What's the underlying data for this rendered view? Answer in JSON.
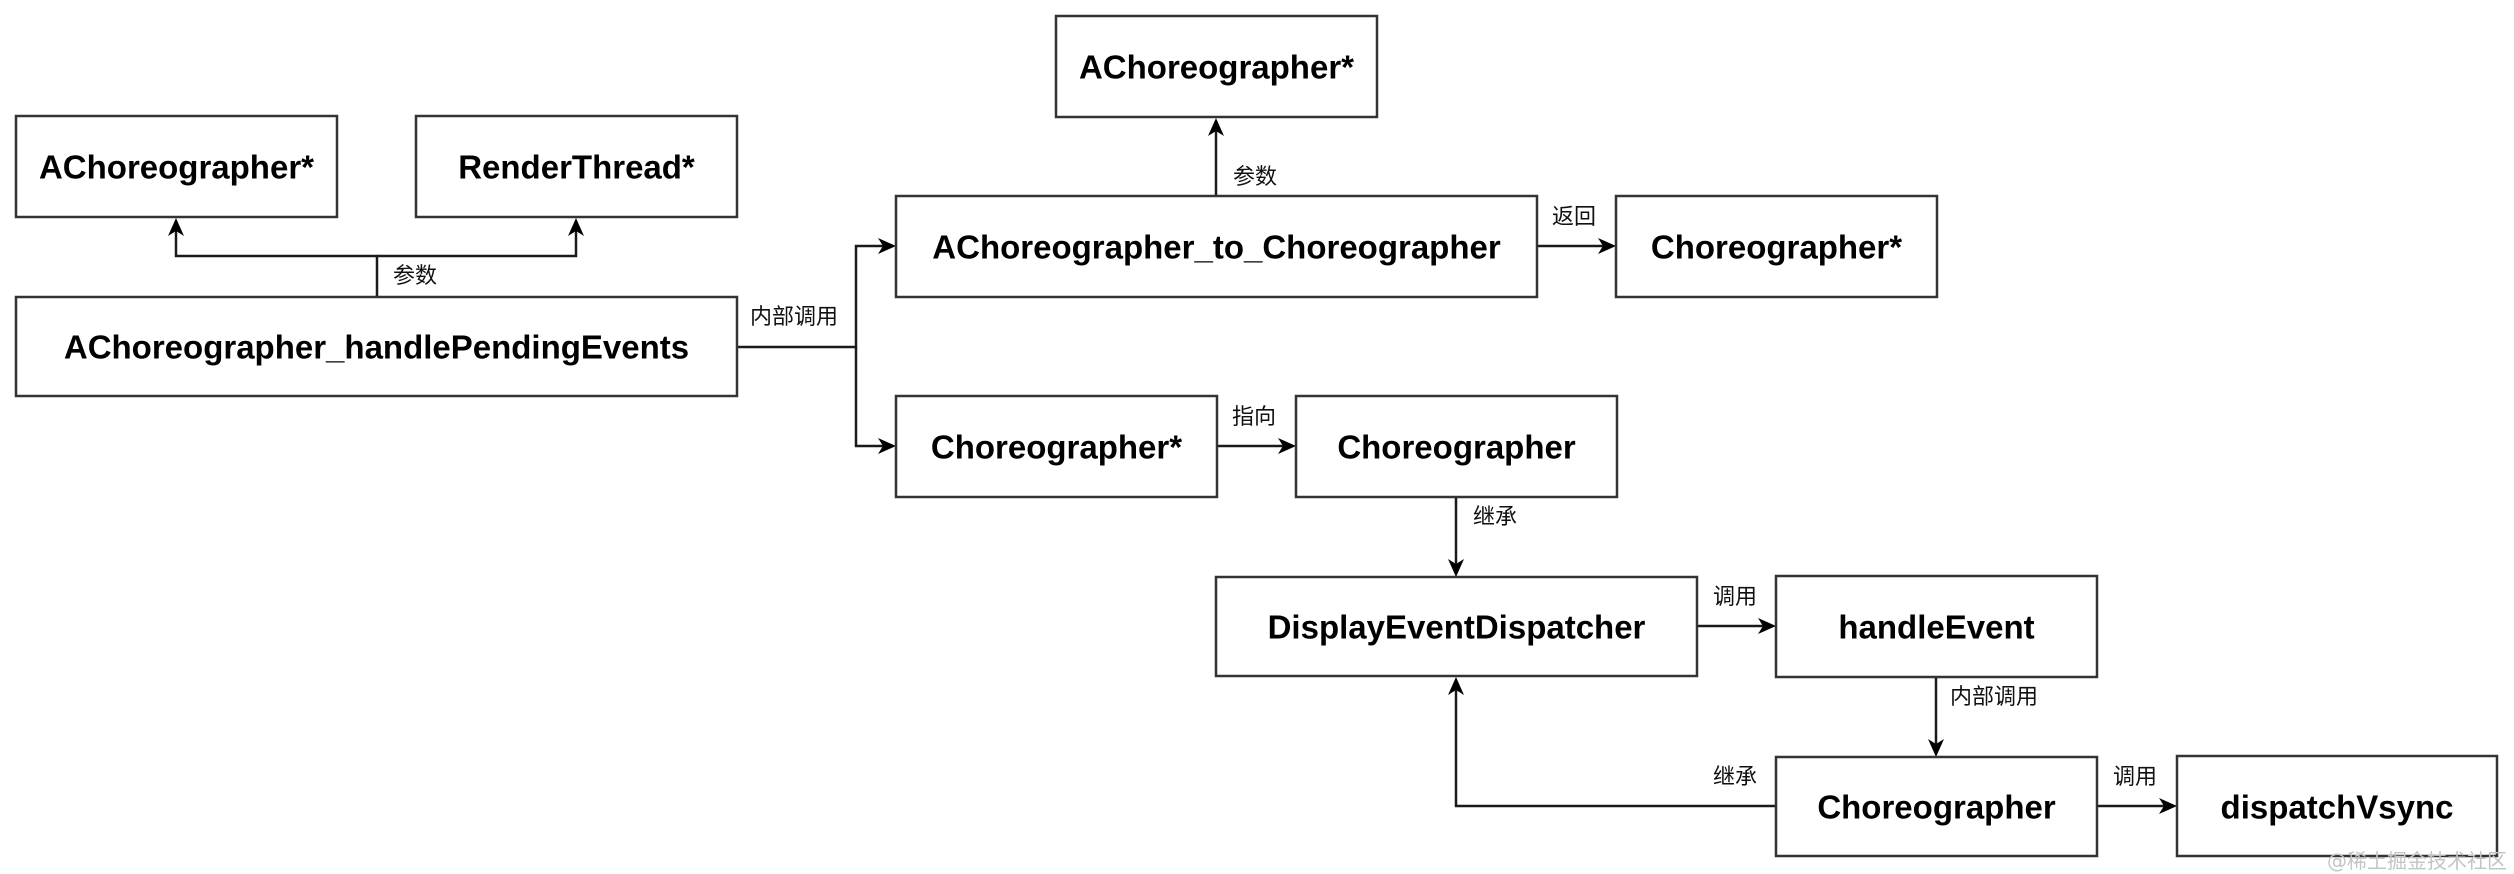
{
  "diagram": {
    "nodes": [
      {
        "id": "n_achoreographer_ptr_left",
        "label": "AChoreographer*"
      },
      {
        "id": "n_renderthread_ptr",
        "label": "RenderThread*"
      },
      {
        "id": "n_handle_pending_events",
        "label": "AChoreographer_handlePendingEvents"
      },
      {
        "id": "n_achoreographer_ptr_top",
        "label": "AChoreographer*"
      },
      {
        "id": "n_achoreographer_to_choreographer",
        "label": "AChoreographer_to_Choreographer"
      },
      {
        "id": "n_choreographer_ptr_right",
        "label": "Choreographer*"
      },
      {
        "id": "n_choreographer_ptr_mid",
        "label": "Choreographer*"
      },
      {
        "id": "n_choreographer_mid",
        "label": "Choreographer"
      },
      {
        "id": "n_display_event_dispatcher",
        "label": "DisplayEventDispatcher"
      },
      {
        "id": "n_handle_event",
        "label": "handleEvent"
      },
      {
        "id": "n_choreographer_bottom",
        "label": "Choreographer"
      },
      {
        "id": "n_dispatch_vsync",
        "label": "dispatchVsync"
      }
    ],
    "edges": [
      {
        "from": "n_handle_pending_events",
        "to": "n_achoreographer_ptr_left",
        "label": "参数"
      },
      {
        "from": "n_handle_pending_events",
        "to": "n_renderthread_ptr",
        "label": "参数"
      },
      {
        "from": "n_handle_pending_events",
        "to": "n_achoreographer_to_choreographer",
        "label": "内部调用"
      },
      {
        "from": "n_handle_pending_events",
        "to": "n_choreographer_ptr_mid",
        "label": "内部调用"
      },
      {
        "from": "n_achoreographer_to_choreographer",
        "to": "n_achoreographer_ptr_top",
        "label": "参数"
      },
      {
        "from": "n_achoreographer_to_choreographer",
        "to": "n_choreographer_ptr_right",
        "label": "返回"
      },
      {
        "from": "n_choreographer_ptr_mid",
        "to": "n_choreographer_mid",
        "label": "指向"
      },
      {
        "from": "n_choreographer_mid",
        "to": "n_display_event_dispatcher",
        "label": "继承"
      },
      {
        "from": "n_display_event_dispatcher",
        "to": "n_handle_event",
        "label": "调用"
      },
      {
        "from": "n_handle_event",
        "to": "n_choreographer_bottom",
        "label": "内部调用"
      },
      {
        "from": "n_choreographer_bottom",
        "to": "n_display_event_dispatcher",
        "label": "继承"
      },
      {
        "from": "n_choreographer_bottom",
        "to": "n_dispatch_vsync",
        "label": "调用"
      }
    ],
    "edge_labels": {
      "params_left": "参数",
      "internal_call_left": "内部调用",
      "params_top": "参数",
      "returns": "返回",
      "points_to": "指向",
      "inherits_mid": "继承",
      "call_handle_event": "调用",
      "internal_call_right": "内部调用",
      "inherits_bottom": "继承",
      "call_dispatch_vsync": "调用"
    }
  },
  "watermark": "@稀土掘金技术社区"
}
